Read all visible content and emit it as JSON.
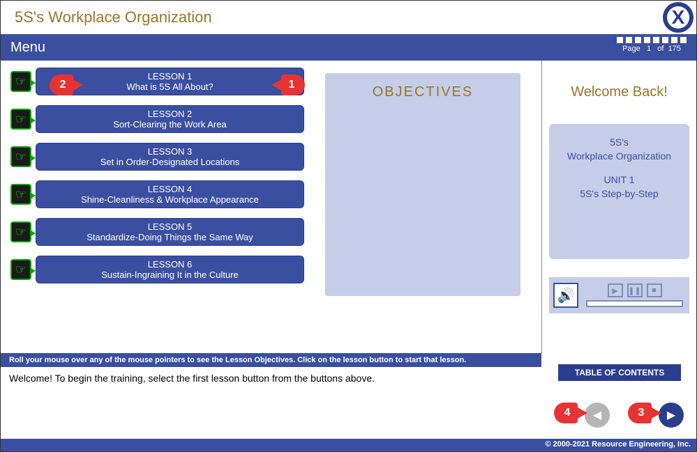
{
  "header": {
    "title": "5S's Workplace Organization",
    "menu_label": "Menu",
    "page_label": "Page",
    "page_current": "1",
    "page_of": "of",
    "page_total": "175"
  },
  "lessons": [
    {
      "title": "LESSON 1",
      "subtitle": "What is 5S All About?"
    },
    {
      "title": "LESSON 2",
      "subtitle": "Sort-Clearing the Work Area"
    },
    {
      "title": "LESSON 3",
      "subtitle": "Set in Order-Designated Locations"
    },
    {
      "title": "LESSON 4",
      "subtitle": "Shine-Cleanliness & Workplace Appearance"
    },
    {
      "title": "LESSON 5",
      "subtitle": "Standardize-Doing Things the Same Way"
    },
    {
      "title": "LESSON 6",
      "subtitle": "Sustain-Ingraining It in the Culture"
    }
  ],
  "objectives": {
    "heading": "OBJECTIVES"
  },
  "sidebar": {
    "welcome": "Welcome Back!",
    "course_line1": "5S's",
    "course_line2": "Workplace Organization",
    "unit_line1": "UNIT 1",
    "unit_line2": "5S's Step-by-Step",
    "toc_label": "TABLE OF CONTENTS"
  },
  "instruction": "Roll your mouse over any of the mouse pointers to see the Lesson Objectives. Click on the lesson button to start that lesson.",
  "welcome_text": "Welcome! To begin the training, select the first lesson button from the buttons above.",
  "footer": "© 2000-2021 Resource Engineering, Inc.",
  "callouts": {
    "c1": "1",
    "c2": "2",
    "c3": "3",
    "c4": "4"
  }
}
